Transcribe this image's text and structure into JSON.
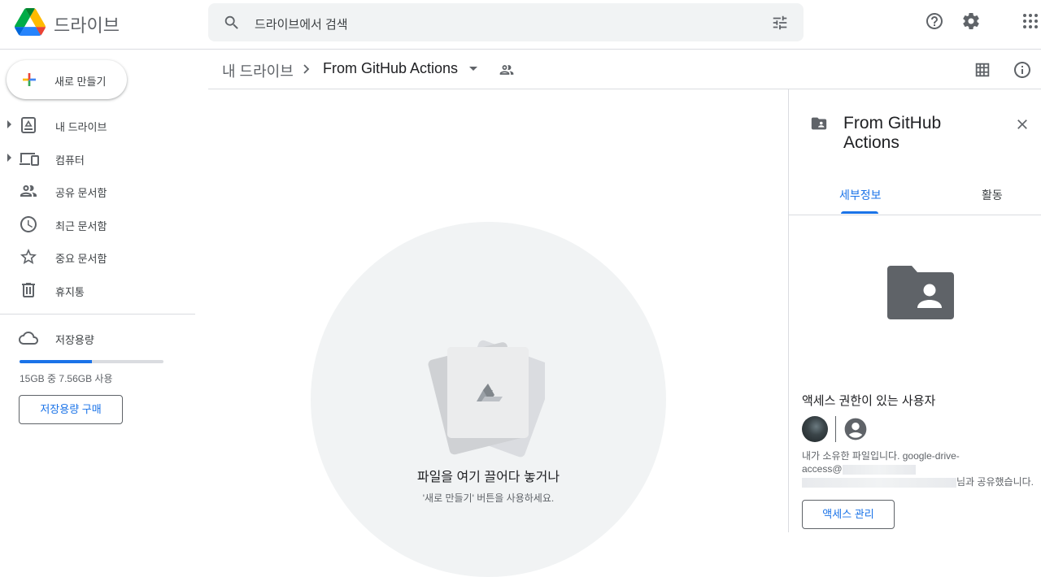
{
  "app": {
    "title": "드라이브"
  },
  "search": {
    "placeholder": "드라이브에서 검색"
  },
  "nav": {
    "new_label": "새로 만들기",
    "items": [
      {
        "label": "내 드라이브",
        "icon": "my-drive-icon",
        "expandable": true
      },
      {
        "label": "컴퓨터",
        "icon": "computer-icon",
        "expandable": true
      },
      {
        "label": "공유 문서함",
        "icon": "people-icon",
        "expandable": false
      },
      {
        "label": "최근 문서함",
        "icon": "clock-icon",
        "expandable": false
      },
      {
        "label": "중요 문서함",
        "icon": "star-icon",
        "expandable": false
      },
      {
        "label": "휴지통",
        "icon": "trash-icon",
        "expandable": false
      }
    ],
    "storage": {
      "label": "저장용량",
      "text": "15GB 중 7.56GB 사용",
      "used_fraction": 0.504,
      "buy_label": "저장용량 구매"
    }
  },
  "breadcrumb": {
    "root": "내 드라이브",
    "current": "From GitHub Actions"
  },
  "empty_state": {
    "title": "파일을 여기 끌어다 놓거나",
    "subtitle": "'새로 만들기' 버튼을 사용하세요."
  },
  "details": {
    "title": "From GitHub Actions",
    "tabs": {
      "details": "세부정보",
      "activity": "활동"
    },
    "access_title": "액세스 권한이 있는 사용자",
    "share_text_1": "내가 소유한 파일입니다. google-drive-",
    "share_text_2": "access@",
    "share_text_3": "님과 공유했습니다.",
    "manage_label": "액세스 관리"
  },
  "colors": {
    "accent": "#1a73e8",
    "icon": "#5f6368",
    "folder": "#5f6368"
  }
}
